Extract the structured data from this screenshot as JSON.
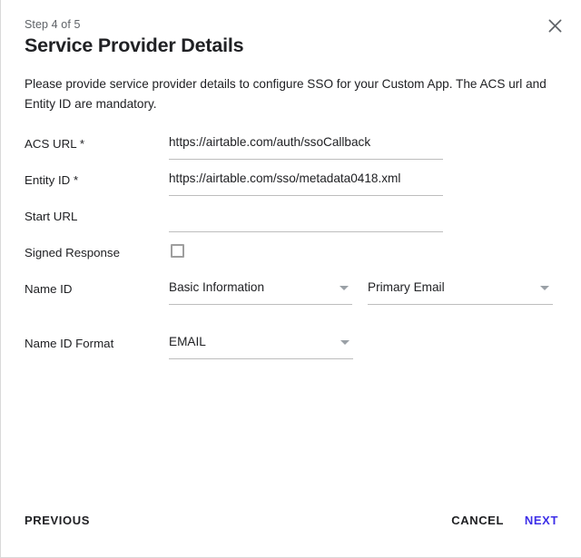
{
  "dialog": {
    "step_label": "Step 4 of 5",
    "title": "Service Provider Details",
    "description": "Please provide service provider details to configure SSO for your Custom App. The ACS url and Entity ID are mandatory.",
    "close_icon": "close-icon"
  },
  "form": {
    "fields": [
      {
        "label": "ACS URL *",
        "type": "text",
        "value": "https://airtable.com/auth/ssoCallback",
        "placeholder": ""
      },
      {
        "label": "Entity ID *",
        "type": "text",
        "value": "https://airtable.com/sso/metadata0418.xml",
        "placeholder": ""
      },
      {
        "label": "Start URL",
        "type": "text",
        "value": "",
        "placeholder": ""
      },
      {
        "label": "Signed Response",
        "type": "checkbox",
        "checked": false
      },
      {
        "label": "Name ID",
        "type": "select-pair",
        "value_primary": "Basic Information",
        "value_secondary": "Primary Email",
        "arrow_icon": "chevron-down-icon"
      },
      {
        "label": "Name ID Format",
        "type": "select",
        "value": "EMAIL",
        "arrow_icon": "chevron-down-icon"
      }
    ]
  },
  "footer": {
    "previous_label": "PREVIOUS",
    "cancel_label": "CANCEL",
    "next_label": "NEXT"
  },
  "colors": {
    "accent": "#3d2fe8",
    "text": "#202124",
    "muted": "#5f6368",
    "underline": "#bdbdbd",
    "checkbox_border": "#9e9e9e",
    "arrow": "#9aa0a6",
    "dialog_border": "#d9d9d9"
  }
}
